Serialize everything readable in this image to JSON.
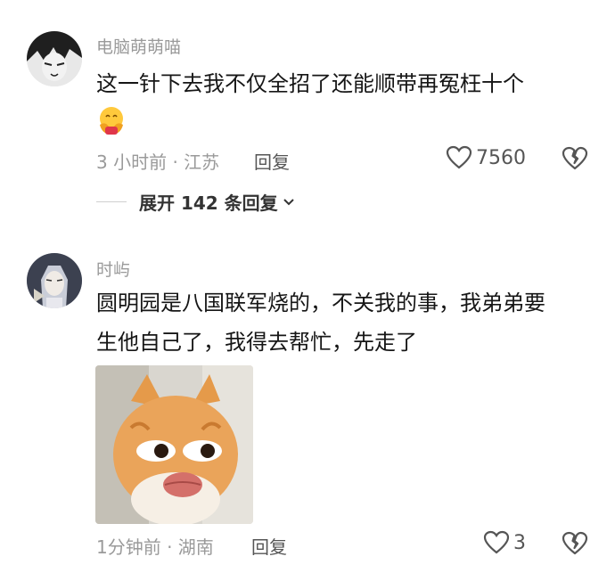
{
  "comments": [
    {
      "username": "电脑萌萌喵",
      "text": "这一针下去我不仅全招了还能顺带再冤枉十个",
      "emoji": "hug-emoji",
      "time_location": "3 小时前 · 江苏",
      "reply_label": "回复",
      "like_count": "7560"
    },
    {
      "username": "时屿",
      "text_line1": "圆明园是八国联军烧的，不关我的事，我弟弟要",
      "text_line2": "生他自己了，我得去帮忙，先走了",
      "image": "cat-sticker",
      "time_location": "1分钟前 · 湖南",
      "reply_label": "回复",
      "like_count": "3"
    }
  ],
  "expand_replies": "展开 142 条回复",
  "icons": [
    "heart-icon",
    "broken-heart-icon",
    "chevron-down-icon"
  ]
}
